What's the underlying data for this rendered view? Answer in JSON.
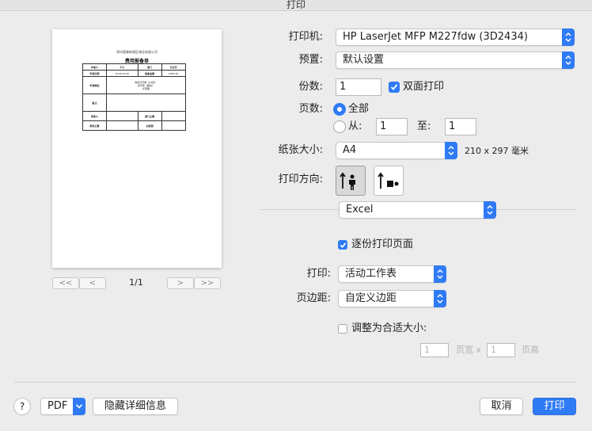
{
  "window": {
    "title": "打印"
  },
  "preview": {
    "doc_company": "郑州葛森新增区域化有限公司",
    "doc_title": "费用报备单",
    "rows": [
      [
        "申请人",
        "李某",
        "部门",
        "数据部"
      ],
      [
        "申请日期",
        "2016/12/16",
        "报备金额",
        "¥580.00"
      ],
      [
        "申请原因",
        "购买打印纸（A4纸）\n签字笔（黑色）\n计算器",
        "",
        ""
      ],
      [
        "备注",
        "",
        "",
        ""
      ],
      [
        "审核人",
        "",
        "部门主管",
        ""
      ],
      [
        "财务主管",
        "",
        "总经理",
        ""
      ]
    ],
    "page_indicator": "1/1",
    "first_label": "<<",
    "prev_label": "<",
    "next_label": ">",
    "last_label": ">>"
  },
  "form": {
    "printer_label": "打印机:",
    "printer_value": "HP LaserJet MFP M227fdw (3D2434)",
    "preset_label": "预置:",
    "preset_value": "默认设置",
    "copies_label": "份数:",
    "copies_value": "1",
    "duplex_label": "双面打印",
    "pages_label": "页数:",
    "pages_all_label": "全部",
    "pages_from_label": "从:",
    "pages_from_value": "1",
    "pages_to_label": "至:",
    "pages_to_value": "1",
    "paper_label": "纸张大小:",
    "paper_value": "A4",
    "paper_dims": "210 x 297 毫米",
    "orientation_label": "打印方向:",
    "app_value": "Excel",
    "collate_label": "逐份打印页面",
    "print_label": "打印:",
    "print_value": "活动工作表",
    "margin_label": "页边距:",
    "margin_value": "自定义边距",
    "fit_label": "调整为合适大小:",
    "fit_width_value": "1",
    "fit_width_unit": "页宽 x",
    "fit_height_value": "1",
    "fit_height_unit": "页高"
  },
  "footer": {
    "help_label": "?",
    "pdf_label": "PDF",
    "hide_details_label": "隐藏详细信息",
    "cancel_label": "取消",
    "print_label": "打印"
  },
  "colors": {
    "accent": "#2f7bf5",
    "background": "#ececec"
  }
}
